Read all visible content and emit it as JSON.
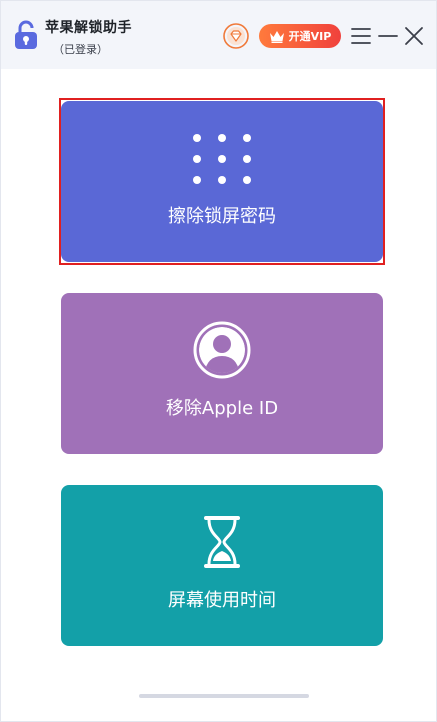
{
  "app": {
    "title": "苹果解锁助手",
    "login_status": "（已登录）",
    "icon": "padlock-icon"
  },
  "toolbar": {
    "vip_label": "开通VIP",
    "vip_icon": "crown-icon",
    "diamond_icon": "diamond-icon",
    "menu_icon": "menu-icon",
    "minimize_icon": "minimize-icon",
    "close_icon": "close-icon"
  },
  "features": [
    {
      "label": "擦除锁屏密码",
      "icon": "dots-grid-icon",
      "color": "#5a68d6",
      "selected": true
    },
    {
      "label": "移除Apple ID",
      "icon": "user-avatar-icon",
      "color": "#a071b8",
      "selected": false
    },
    {
      "label": "屏幕使用时间",
      "icon": "hourglass-icon",
      "color": "#13a0a8",
      "selected": false
    }
  ],
  "colors": {
    "accent_red": "#e02020",
    "vip_gradient_start": "#ff7a3c",
    "vip_gradient_end": "#f0413c"
  }
}
